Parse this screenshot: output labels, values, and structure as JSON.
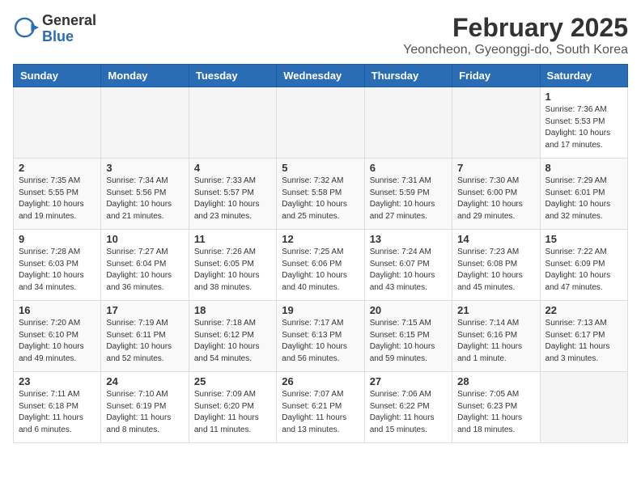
{
  "logo": {
    "general": "General",
    "blue": "Blue"
  },
  "title": "February 2025",
  "subtitle": "Yeoncheon, Gyeonggi-do, South Korea",
  "days_of_week": [
    "Sunday",
    "Monday",
    "Tuesday",
    "Wednesday",
    "Thursday",
    "Friday",
    "Saturday"
  ],
  "weeks": [
    [
      {
        "day": "",
        "info": ""
      },
      {
        "day": "",
        "info": ""
      },
      {
        "day": "",
        "info": ""
      },
      {
        "day": "",
        "info": ""
      },
      {
        "day": "",
        "info": ""
      },
      {
        "day": "",
        "info": ""
      },
      {
        "day": "1",
        "info": "Sunrise: 7:36 AM\nSunset: 5:53 PM\nDaylight: 10 hours\nand 17 minutes."
      }
    ],
    [
      {
        "day": "2",
        "info": "Sunrise: 7:35 AM\nSunset: 5:55 PM\nDaylight: 10 hours\nand 19 minutes."
      },
      {
        "day": "3",
        "info": "Sunrise: 7:34 AM\nSunset: 5:56 PM\nDaylight: 10 hours\nand 21 minutes."
      },
      {
        "day": "4",
        "info": "Sunrise: 7:33 AM\nSunset: 5:57 PM\nDaylight: 10 hours\nand 23 minutes."
      },
      {
        "day": "5",
        "info": "Sunrise: 7:32 AM\nSunset: 5:58 PM\nDaylight: 10 hours\nand 25 minutes."
      },
      {
        "day": "6",
        "info": "Sunrise: 7:31 AM\nSunset: 5:59 PM\nDaylight: 10 hours\nand 27 minutes."
      },
      {
        "day": "7",
        "info": "Sunrise: 7:30 AM\nSunset: 6:00 PM\nDaylight: 10 hours\nand 29 minutes."
      },
      {
        "day": "8",
        "info": "Sunrise: 7:29 AM\nSunset: 6:01 PM\nDaylight: 10 hours\nand 32 minutes."
      }
    ],
    [
      {
        "day": "9",
        "info": "Sunrise: 7:28 AM\nSunset: 6:03 PM\nDaylight: 10 hours\nand 34 minutes."
      },
      {
        "day": "10",
        "info": "Sunrise: 7:27 AM\nSunset: 6:04 PM\nDaylight: 10 hours\nand 36 minutes."
      },
      {
        "day": "11",
        "info": "Sunrise: 7:26 AM\nSunset: 6:05 PM\nDaylight: 10 hours\nand 38 minutes."
      },
      {
        "day": "12",
        "info": "Sunrise: 7:25 AM\nSunset: 6:06 PM\nDaylight: 10 hours\nand 40 minutes."
      },
      {
        "day": "13",
        "info": "Sunrise: 7:24 AM\nSunset: 6:07 PM\nDaylight: 10 hours\nand 43 minutes."
      },
      {
        "day": "14",
        "info": "Sunrise: 7:23 AM\nSunset: 6:08 PM\nDaylight: 10 hours\nand 45 minutes."
      },
      {
        "day": "15",
        "info": "Sunrise: 7:22 AM\nSunset: 6:09 PM\nDaylight: 10 hours\nand 47 minutes."
      }
    ],
    [
      {
        "day": "16",
        "info": "Sunrise: 7:20 AM\nSunset: 6:10 PM\nDaylight: 10 hours\nand 49 minutes."
      },
      {
        "day": "17",
        "info": "Sunrise: 7:19 AM\nSunset: 6:11 PM\nDaylight: 10 hours\nand 52 minutes."
      },
      {
        "day": "18",
        "info": "Sunrise: 7:18 AM\nSunset: 6:12 PM\nDaylight: 10 hours\nand 54 minutes."
      },
      {
        "day": "19",
        "info": "Sunrise: 7:17 AM\nSunset: 6:13 PM\nDaylight: 10 hours\nand 56 minutes."
      },
      {
        "day": "20",
        "info": "Sunrise: 7:15 AM\nSunset: 6:15 PM\nDaylight: 10 hours\nand 59 minutes."
      },
      {
        "day": "21",
        "info": "Sunrise: 7:14 AM\nSunset: 6:16 PM\nDaylight: 11 hours\nand 1 minute."
      },
      {
        "day": "22",
        "info": "Sunrise: 7:13 AM\nSunset: 6:17 PM\nDaylight: 11 hours\nand 3 minutes."
      }
    ],
    [
      {
        "day": "23",
        "info": "Sunrise: 7:11 AM\nSunset: 6:18 PM\nDaylight: 11 hours\nand 6 minutes."
      },
      {
        "day": "24",
        "info": "Sunrise: 7:10 AM\nSunset: 6:19 PM\nDaylight: 11 hours\nand 8 minutes."
      },
      {
        "day": "25",
        "info": "Sunrise: 7:09 AM\nSunset: 6:20 PM\nDaylight: 11 hours\nand 11 minutes."
      },
      {
        "day": "26",
        "info": "Sunrise: 7:07 AM\nSunset: 6:21 PM\nDaylight: 11 hours\nand 13 minutes."
      },
      {
        "day": "27",
        "info": "Sunrise: 7:06 AM\nSunset: 6:22 PM\nDaylight: 11 hours\nand 15 minutes."
      },
      {
        "day": "28",
        "info": "Sunrise: 7:05 AM\nSunset: 6:23 PM\nDaylight: 11 hours\nand 18 minutes."
      },
      {
        "day": "",
        "info": ""
      }
    ]
  ]
}
